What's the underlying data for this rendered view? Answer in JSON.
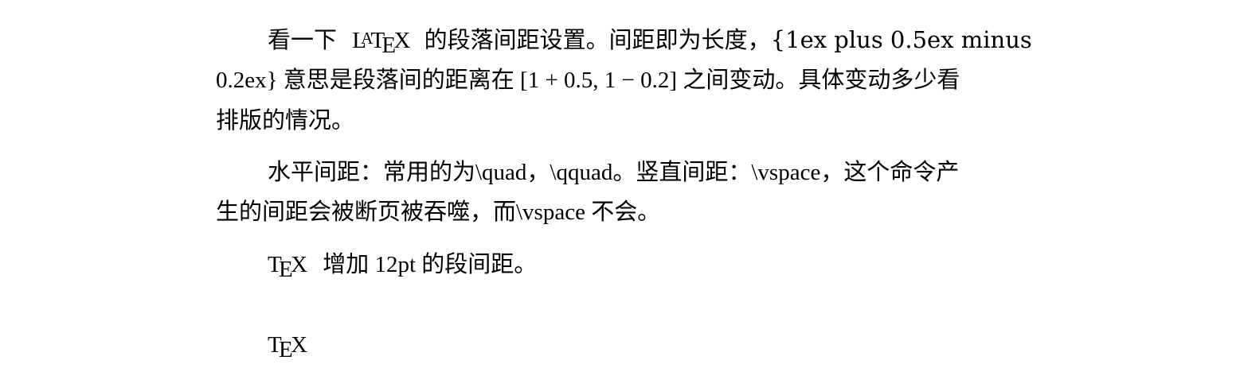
{
  "document": {
    "paragraph1": {
      "line1_a": "看一下",
      "line1_logo_L": "L",
      "line1_logo_A": "A",
      "line1_logo_T": "T",
      "line1_logo_E": "E",
      "line1_logo_X": "X",
      "line1_b": "的段落间距设置。间距即为长度，{1ex plus 0.5ex minus",
      "line2": "0.2ex} 意思是段落间的距离在 [1 + 0.5, 1 − 0.2] 之间变动。具体变动多少看",
      "line3": "排版的情况。"
    },
    "paragraph2": {
      "line1": "水平间距：常用的为\\quad，\\qquad。竖直间距：\\vspace，这个命令产",
      "line2": "生的间距会被断页被吞噬，而\\vspace 不会。"
    },
    "paragraph3": {
      "logo_T": "T",
      "logo_E": "E",
      "logo_X": "X",
      "text": "增加 12pt 的段间距。"
    },
    "paragraph4": {
      "logo_T": "T",
      "logo_E": "E",
      "logo_X": "X"
    }
  }
}
